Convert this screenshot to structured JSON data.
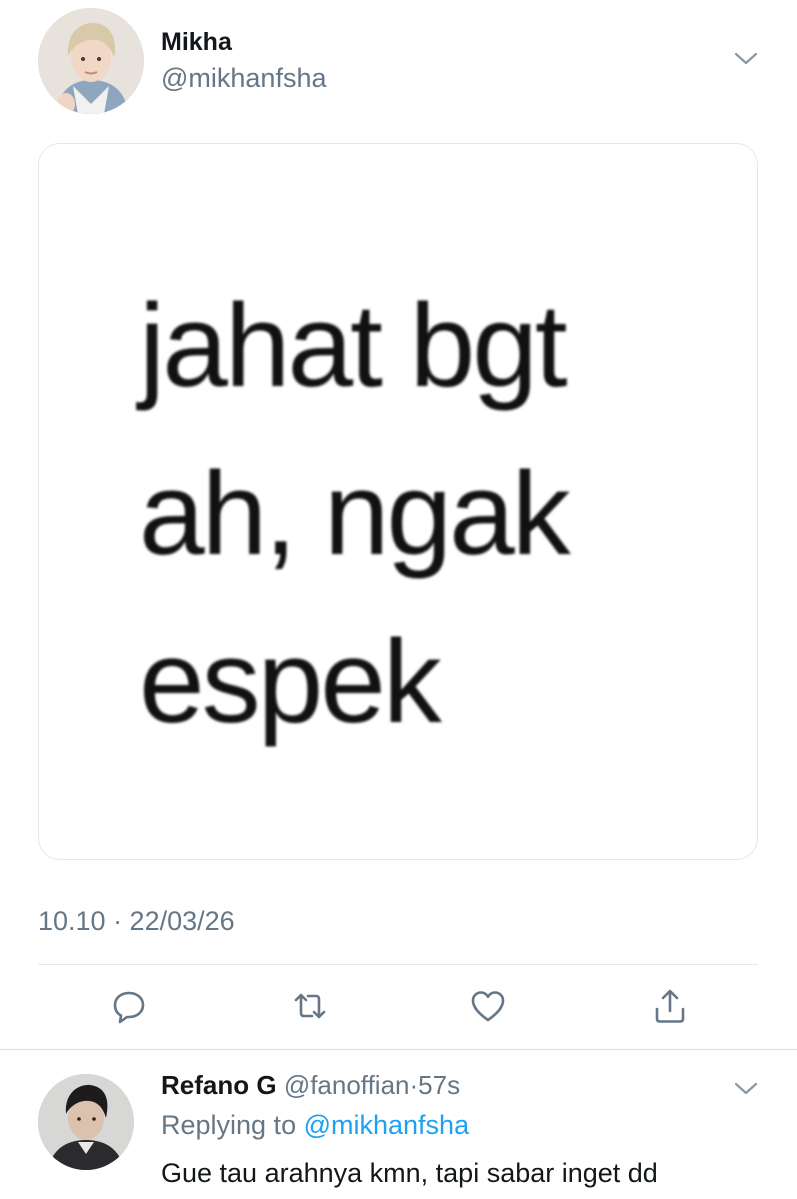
{
  "tweet": {
    "author": {
      "name": "Mikha",
      "handle": "@mikhanfsha"
    },
    "media_text": [
      "jahat bgt",
      "ah, ngak",
      "espek"
    ],
    "timestamp": "10.10 · 22/03/26",
    "actions": [
      "reply-icon",
      "retweet-icon",
      "like-icon",
      "share-icon"
    ]
  },
  "reply": {
    "author": {
      "name": "Refano G",
      "handle": "@fanoffian",
      "time": "57s"
    },
    "replying_label": "Replying to",
    "replying_to": "@mikhanfsha",
    "text": "Gue tau arahnya kmn, tapi sabar inget dd"
  },
  "colors": {
    "secondary_text": "#657786",
    "link": "#1da1f2",
    "border": "#e1e8ed"
  }
}
